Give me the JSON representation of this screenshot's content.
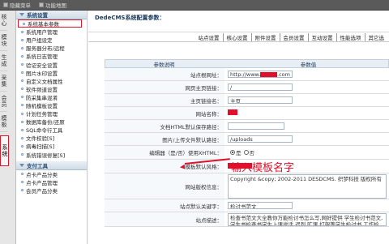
{
  "topbar": {
    "items": [
      "隐藏菜单",
      "功能地图"
    ]
  },
  "leftnav": {
    "items": [
      "核心",
      "模块",
      "生成",
      "采集",
      "会员",
      "模板",
      "系统"
    ],
    "selected": 6
  },
  "sidebar": {
    "group1": {
      "title": "系统设置",
      "items": [
        "系统基本参数",
        "系统用户管理",
        "用户组设定",
        "服务器分布/远程",
        "系统日志管理",
        "验证安全设置",
        "图片水印设置",
        "自定义文档属性",
        "软件频道设置",
        "防采集串混淆",
        "随机模板设置",
        "计划任务管理",
        "数据库备份/还原",
        "SQL命令行工具",
        "文件校验[S]",
        "病毒扫描[S]",
        "系统错误修复[S]"
      ],
      "highlighted": 0
    },
    "group2": {
      "title": "支付工具",
      "items": [
        "点卡产品分类",
        "点卡产品管理",
        "会员产品分类"
      ]
    }
  },
  "main": {
    "header": "DedeCMS系统配置参数：",
    "tabs": [
      "站点设置",
      "核心设置",
      "附件设置",
      "会员设置",
      "互动设置",
      "性能选项",
      "其它选"
    ],
    "table": {
      "col_label": "参数说明",
      "col_value": "参数值",
      "rows": [
        {
          "label": "站点根网址：",
          "value": "http://www.",
          "suffix": ".com",
          "type": "redacted-url"
        },
        {
          "label": "网页主页链接：",
          "value": "/",
          "type": "input"
        },
        {
          "label": "主页链接名：",
          "value": "主页",
          "type": "input"
        },
        {
          "label": "网站名称：",
          "value": "",
          "type": "redacted"
        },
        {
          "label": "文档HTML默认保存路径：",
          "value": "",
          "type": "empty"
        },
        {
          "label": "图片/上传文件默认路径：",
          "value": "/uploads",
          "type": "input"
        },
        {
          "label": "编辑器（是/否）使用XHTML：",
          "value_yes": "是",
          "value_no": "否",
          "type": "radio"
        },
        {
          "label": "模板默认风格：",
          "value": "",
          "type": "redacted"
        },
        {
          "label": "网站版权信息：",
          "value": "Copyright &copy; 2002-2011 DESDCMS. 织梦科技 版权所有",
          "type": "textarea"
        },
        {
          "label": "站点默认关键字：",
          "value": "检讨书范文",
          "type": "input"
        },
        {
          "label": "站点描述：",
          "value": "检查书范文大全教你万能检讨书怎么写,网好提供 学生检讨书范文,学生书检查书学生上课说话,迟到,旷课,打架等学生检讨书,工作检讨书,",
          "type": "textarea"
        }
      ]
    }
  },
  "annotation": {
    "text": "输入模板名字"
  }
}
